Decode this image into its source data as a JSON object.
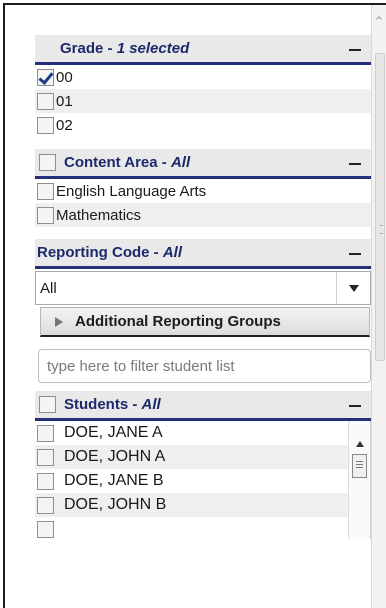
{
  "grade": {
    "title": "Grade - ",
    "selection": "1 selected",
    "items": [
      {
        "label": "00",
        "checked": true
      },
      {
        "label": "01",
        "checked": false
      },
      {
        "label": "02",
        "checked": false
      }
    ]
  },
  "content_area": {
    "title": "Content Area - ",
    "selection": "All",
    "items": [
      {
        "label": "English Language Arts",
        "checked": false
      },
      {
        "label": "Mathematics",
        "checked": false
      }
    ]
  },
  "reporting_code": {
    "title": "Reporting Code - ",
    "selection": "All",
    "dropdown_value": "All"
  },
  "additional_groups": {
    "label": "Additional Reporting Groups"
  },
  "filter": {
    "placeholder": "type here to filter student list"
  },
  "students": {
    "title": "Students - ",
    "selection": "All",
    "items": [
      {
        "label": "DOE, JANE A"
      },
      {
        "label": "DOE, JOHN A"
      },
      {
        "label": "DOE, JANE B"
      },
      {
        "label": "DOE, JOHN B"
      }
    ]
  },
  "colors": {
    "accent": "#24307a",
    "header_bg": "#e9e9e9",
    "check": "#1d3a8a"
  }
}
